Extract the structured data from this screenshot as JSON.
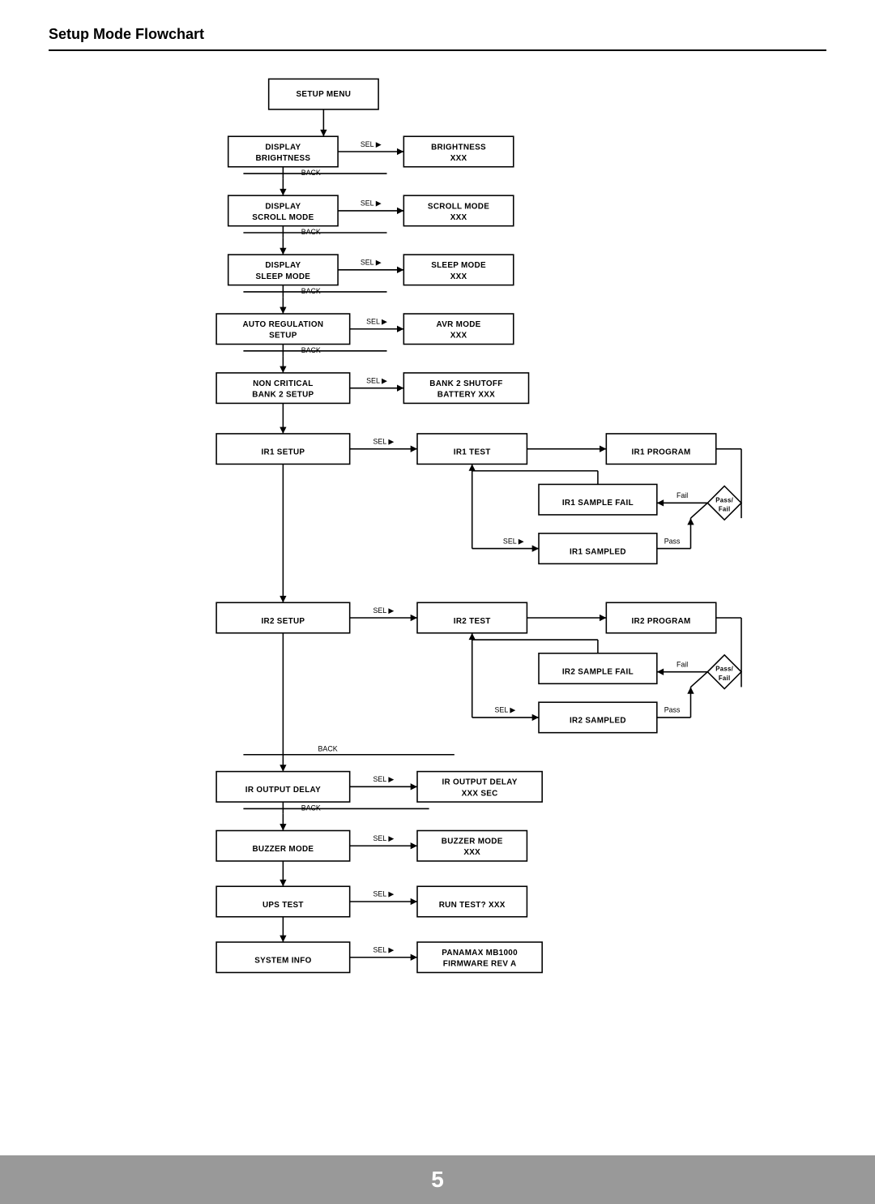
{
  "page": {
    "title": "Setup Mode Flowchart",
    "page_number": "5"
  },
  "flowchart": {
    "nodes": [
      {
        "id": "setup_menu",
        "label": "SETUP MENU"
      },
      {
        "id": "display_brightness",
        "label": "DISPLAY\nBRIGHTNESS"
      },
      {
        "id": "brightness_xxx",
        "label": "BRIGHTNESS\nXXX"
      },
      {
        "id": "display_scroll",
        "label": "DISPLAY\nSCROLL MODE"
      },
      {
        "id": "scroll_mode_xxx",
        "label": "SCROLL MODE\nXXX"
      },
      {
        "id": "display_sleep",
        "label": "DISPLAY\nSLEEP MODE"
      },
      {
        "id": "sleep_mode_xxx",
        "label": "SLEEP MODE\nXXX"
      },
      {
        "id": "auto_regulation",
        "label": "AUTO REGULATION\nSETUP"
      },
      {
        "id": "avr_mode_xxx",
        "label": "AVR MODE\nXXX"
      },
      {
        "id": "non_critical",
        "label": "NON CRITICAL\nBANK 2 SETUP"
      },
      {
        "id": "bank2_shutoff",
        "label": "BANK 2 SHUTOFF\nBATTERY XXX"
      },
      {
        "id": "ir1_setup",
        "label": "IR1 SETUP"
      },
      {
        "id": "ir1_test",
        "label": "IR1 TEST"
      },
      {
        "id": "ir1_program",
        "label": "IR1 PROGRAM"
      },
      {
        "id": "ir1_sample_fail",
        "label": "IR1 SAMPLE FAIL"
      },
      {
        "id": "ir1_sampled",
        "label": "IR1 SAMPLED"
      },
      {
        "id": "ir2_setup",
        "label": "IR2 SETUP"
      },
      {
        "id": "ir2_test",
        "label": "IR2 TEST"
      },
      {
        "id": "ir2_program",
        "label": "IR2 PROGRAM"
      },
      {
        "id": "ir2_sample_fail",
        "label": "IR2 SAMPLE FAIL"
      },
      {
        "id": "ir2_sampled",
        "label": "IR2 SAMPLED"
      },
      {
        "id": "ir_output_delay",
        "label": "IR OUTPUT DELAY"
      },
      {
        "id": "ir_output_delay_xxx",
        "label": "IR OUTPUT DELAY\nXXX SEC"
      },
      {
        "id": "buzzer_mode",
        "label": "BUZZER MODE"
      },
      {
        "id": "buzzer_mode_xxx",
        "label": "BUZZER MODE\nXXX"
      },
      {
        "id": "ups_test",
        "label": "UPS TEST"
      },
      {
        "id": "run_test_xxx",
        "label": "RUN TEST? XXX"
      },
      {
        "id": "system_info",
        "label": "SYSTEM INFO"
      },
      {
        "id": "panamax_mb1000",
        "label": "PANAMAX MB1000\nFIRMWARE REV A"
      }
    ],
    "labels": {
      "sel": "SEL",
      "back": "BACK",
      "fail": "Fail",
      "pass": "Pass",
      "pass_fail": "Pass/\nFail"
    }
  }
}
